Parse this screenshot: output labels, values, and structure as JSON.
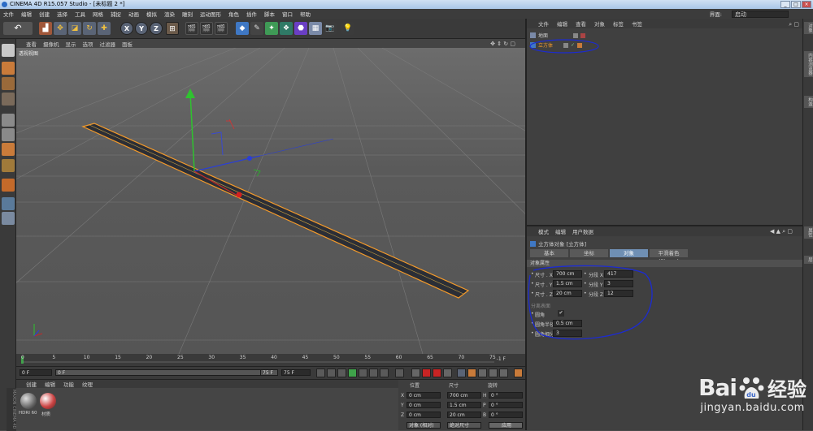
{
  "window": {
    "title": "CINEMA 4D R15.057 Studio - [未标题 2 *]"
  },
  "menu": [
    "文件",
    "编辑",
    "创建",
    "选择",
    "工具",
    "网格",
    "捕捉",
    "动画",
    "模拟",
    "渲染",
    "雕刻",
    "运动图形",
    "角色",
    "插件",
    "脚本",
    "窗口",
    "帮助"
  ],
  "layout": {
    "label": "界面:",
    "value": "启动"
  },
  "viewport": {
    "menu": [
      "查看",
      "摄像机",
      "显示",
      "选项",
      "过滤器",
      "面板"
    ],
    "label": "透视视图"
  },
  "timeline": {
    "ticks": [
      "0",
      "5",
      "10",
      "15",
      "20",
      "25",
      "30",
      "35",
      "40",
      "45",
      "50",
      "55",
      "60",
      "65",
      "70",
      "75"
    ],
    "end_frame": "-1 F",
    "current": "0 F",
    "start": "0 F",
    "range_end": "75 F",
    "max": "75 F"
  },
  "material": {
    "menu": [
      "创建",
      "编辑",
      "功能",
      "纹理"
    ],
    "items": [
      "HDRI 60",
      "材质"
    ]
  },
  "coords": {
    "headers": [
      "位置",
      "尺寸",
      "旋转"
    ],
    "rows": [
      {
        "axis": "X",
        "pos": "0 cm",
        "size": "700 cm",
        "rot_axis": "H",
        "rot": "0 °"
      },
      {
        "axis": "Y",
        "pos": "0 cm",
        "size": "1.5 cm",
        "rot_axis": "P",
        "rot": "0 °"
      },
      {
        "axis": "Z",
        "pos": "0 cm",
        "size": "20 cm",
        "rot_axis": "B",
        "rot": "0 °"
      }
    ],
    "mode": "对象 (相对)",
    "size_mode": "绝对尺寸",
    "apply": "应用"
  },
  "objects": {
    "menu": [
      "文件",
      "编辑",
      "查看",
      "对象",
      "标签",
      "书签"
    ],
    "items": [
      {
        "name": "地面"
      },
      {
        "name": "立方体"
      }
    ]
  },
  "attributes": {
    "menu": [
      "模式",
      "编辑",
      "用户数据"
    ],
    "title": "立方体对象 [立方体]",
    "tabs": [
      "基本",
      "坐标",
      "对象",
      "平滑着色(Phong)"
    ],
    "active_tab": "对象",
    "section": "对象属性",
    "size_x_label": "尺寸 . X",
    "size_x": "700 cm",
    "size_y_label": "尺寸 . Y",
    "size_y": "1.5 cm",
    "size_z_label": "尺寸 . Z",
    "size_z": "20 cm",
    "seg_x_label": "分段 X",
    "seg_x": "417",
    "seg_y_label": "分段 Y",
    "seg_y": "3",
    "seg_z_label": "分段 Z",
    "seg_z": "12",
    "separate_label": "分离表面",
    "fillet_label": "圆角",
    "fillet_checked": "✔",
    "fillet_radius_label": "圆角半径",
    "fillet_radius": "0.5 cm",
    "fillet_sub_label": "圆角细分",
    "fillet_sub": "3"
  },
  "right_tabs": [
    "对象",
    "内容浏览器",
    "构造",
    "属性",
    "层"
  ],
  "brand_vertical": "MAXON CINEMA 4D",
  "watermark": {
    "brand": "Bai",
    "brand2": "经验",
    "url": "jingyan.baidu.com"
  },
  "colors": {
    "accent": "#f39a2a",
    "highlight": "#1c2bd1",
    "tab_active": "#6f8fb3"
  }
}
